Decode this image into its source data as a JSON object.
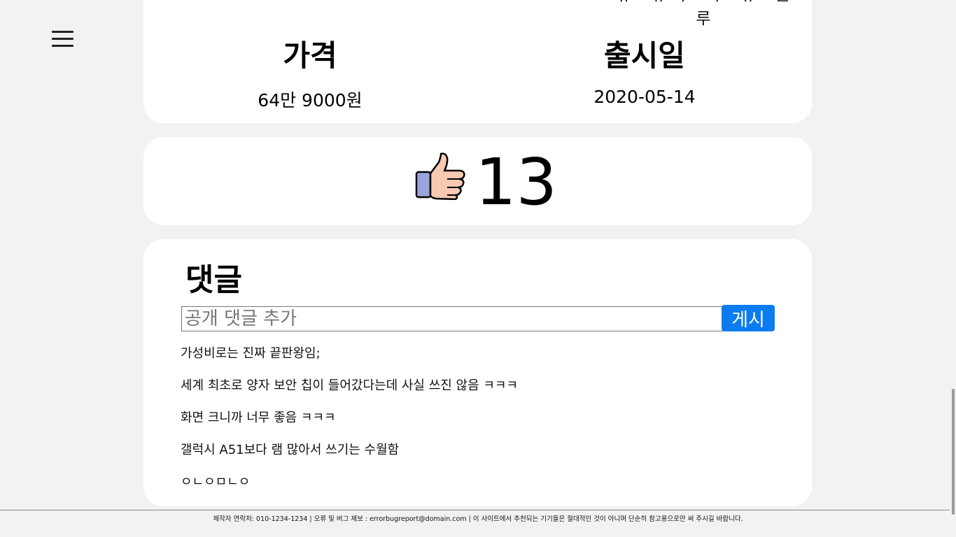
{
  "spec": {
    "cutoff_text": "뉴스 뉴스, 스마트 뉴스 블\n루",
    "price_label": "가격",
    "price_value": "64만 9000원",
    "release_label": "출시일",
    "release_value": "2020-05-14"
  },
  "likes": {
    "count": "13",
    "icon": "thumbs-up-icon"
  },
  "comments": {
    "title": "댓글",
    "input_placeholder": "공개 댓글 추가",
    "input_value": "",
    "post_label": "게시",
    "items": [
      "가성비로는 진짜 끝판왕임;",
      "세계 최초로 양자 보안 칩이 들어갔다는데 사실 쓰진 않음 ㅋㅋㅋ",
      "화면 크니까 너무 좋음 ㅋㅋㅋ",
      "갤럭시 A51보다 램 많아서 쓰기는 수월함",
      "ㅇㄴㅇㅁㄴㅇ"
    ]
  },
  "footer": {
    "text": "제작자 연락처: 010-1234-1234 | 오류 및 버그 제보 : errorbugreport@domain.com | 이 사이트에서 추천되는 기기들은 절대적인 것이 아니며 단순히 참고용으로만 써 주시길 바랍니다."
  },
  "colors": {
    "background": "#f2f2f4",
    "card": "#ffffff",
    "accent": "#0a7cf0",
    "thumb_skin": "#f9c9b2",
    "thumb_cuff": "#9aa3dc"
  }
}
